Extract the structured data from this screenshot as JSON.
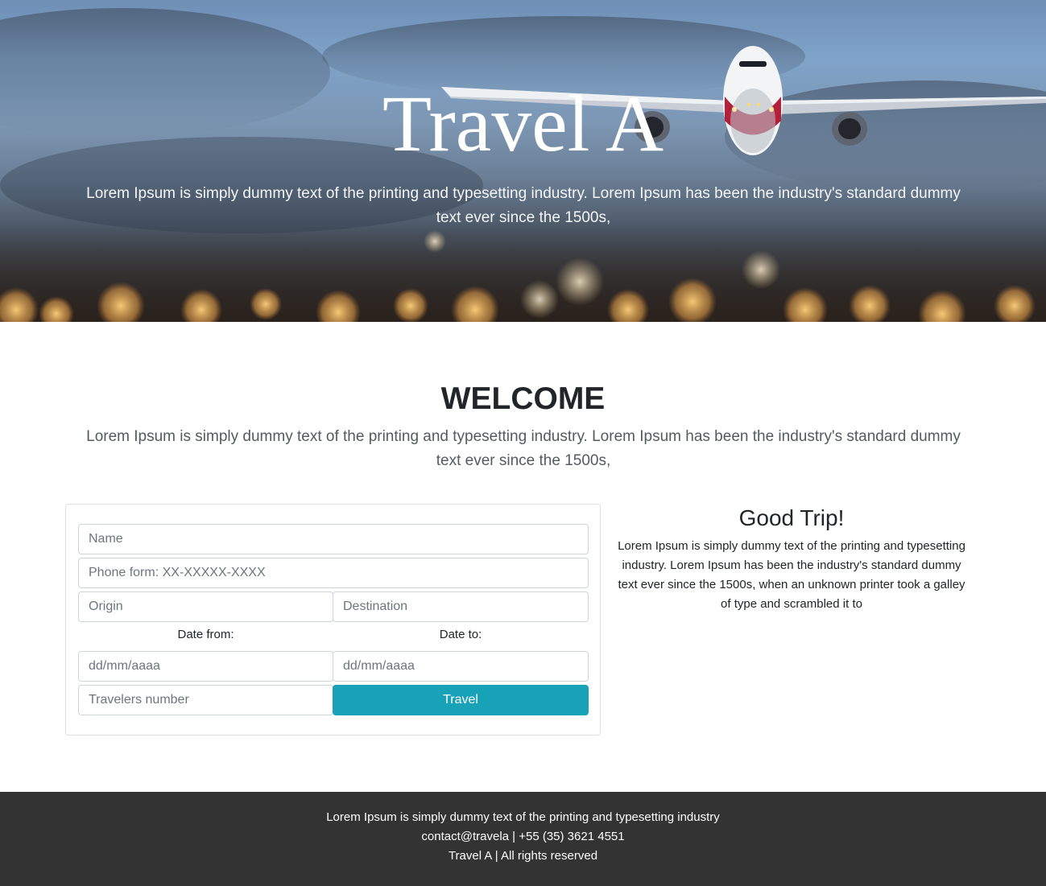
{
  "hero": {
    "title": "Travel A",
    "text": "Lorem Ipsum is simply dummy text of the printing and typesetting industry. Lorem Ipsum has been the industry's standard dummy text ever since the 1500s,"
  },
  "welcome": {
    "title": "WELCOME",
    "text": "Lorem Ipsum is simply dummy text of the printing and typesetting industry. Lorem Ipsum has been the industry's standard dummy text ever since the 1500s,"
  },
  "form": {
    "name_placeholder": "Name",
    "phone_placeholder": "Phone form: XX-XXXXX-XXXX",
    "origin_placeholder": "Origin",
    "destination_placeholder": "Destination",
    "date_from_label": "Date from:",
    "date_to_label": "Date to:",
    "date_from_placeholder": "dd/mm/aaaa",
    "date_to_placeholder": "dd/mm/aaaa",
    "travelers_placeholder": "Travelers number",
    "submit_label": "Travel"
  },
  "side": {
    "title": "Good Trip!",
    "text": "Lorem Ipsum is simply dummy text of the printing and typesetting industry. Lorem Ipsum has been the industry's standard dummy text ever since the 1500s, when an unknown printer took a galley of type and scrambled it to"
  },
  "footer": {
    "line1": "Lorem Ipsum is simply dummy text of the printing and typesetting industry",
    "line2": "contact@travela | +55 (35) 3621 4551",
    "line3": "Travel A | All rights reserved"
  },
  "colors": {
    "accent": "#17a2b8",
    "footer_bg": "#333333"
  }
}
